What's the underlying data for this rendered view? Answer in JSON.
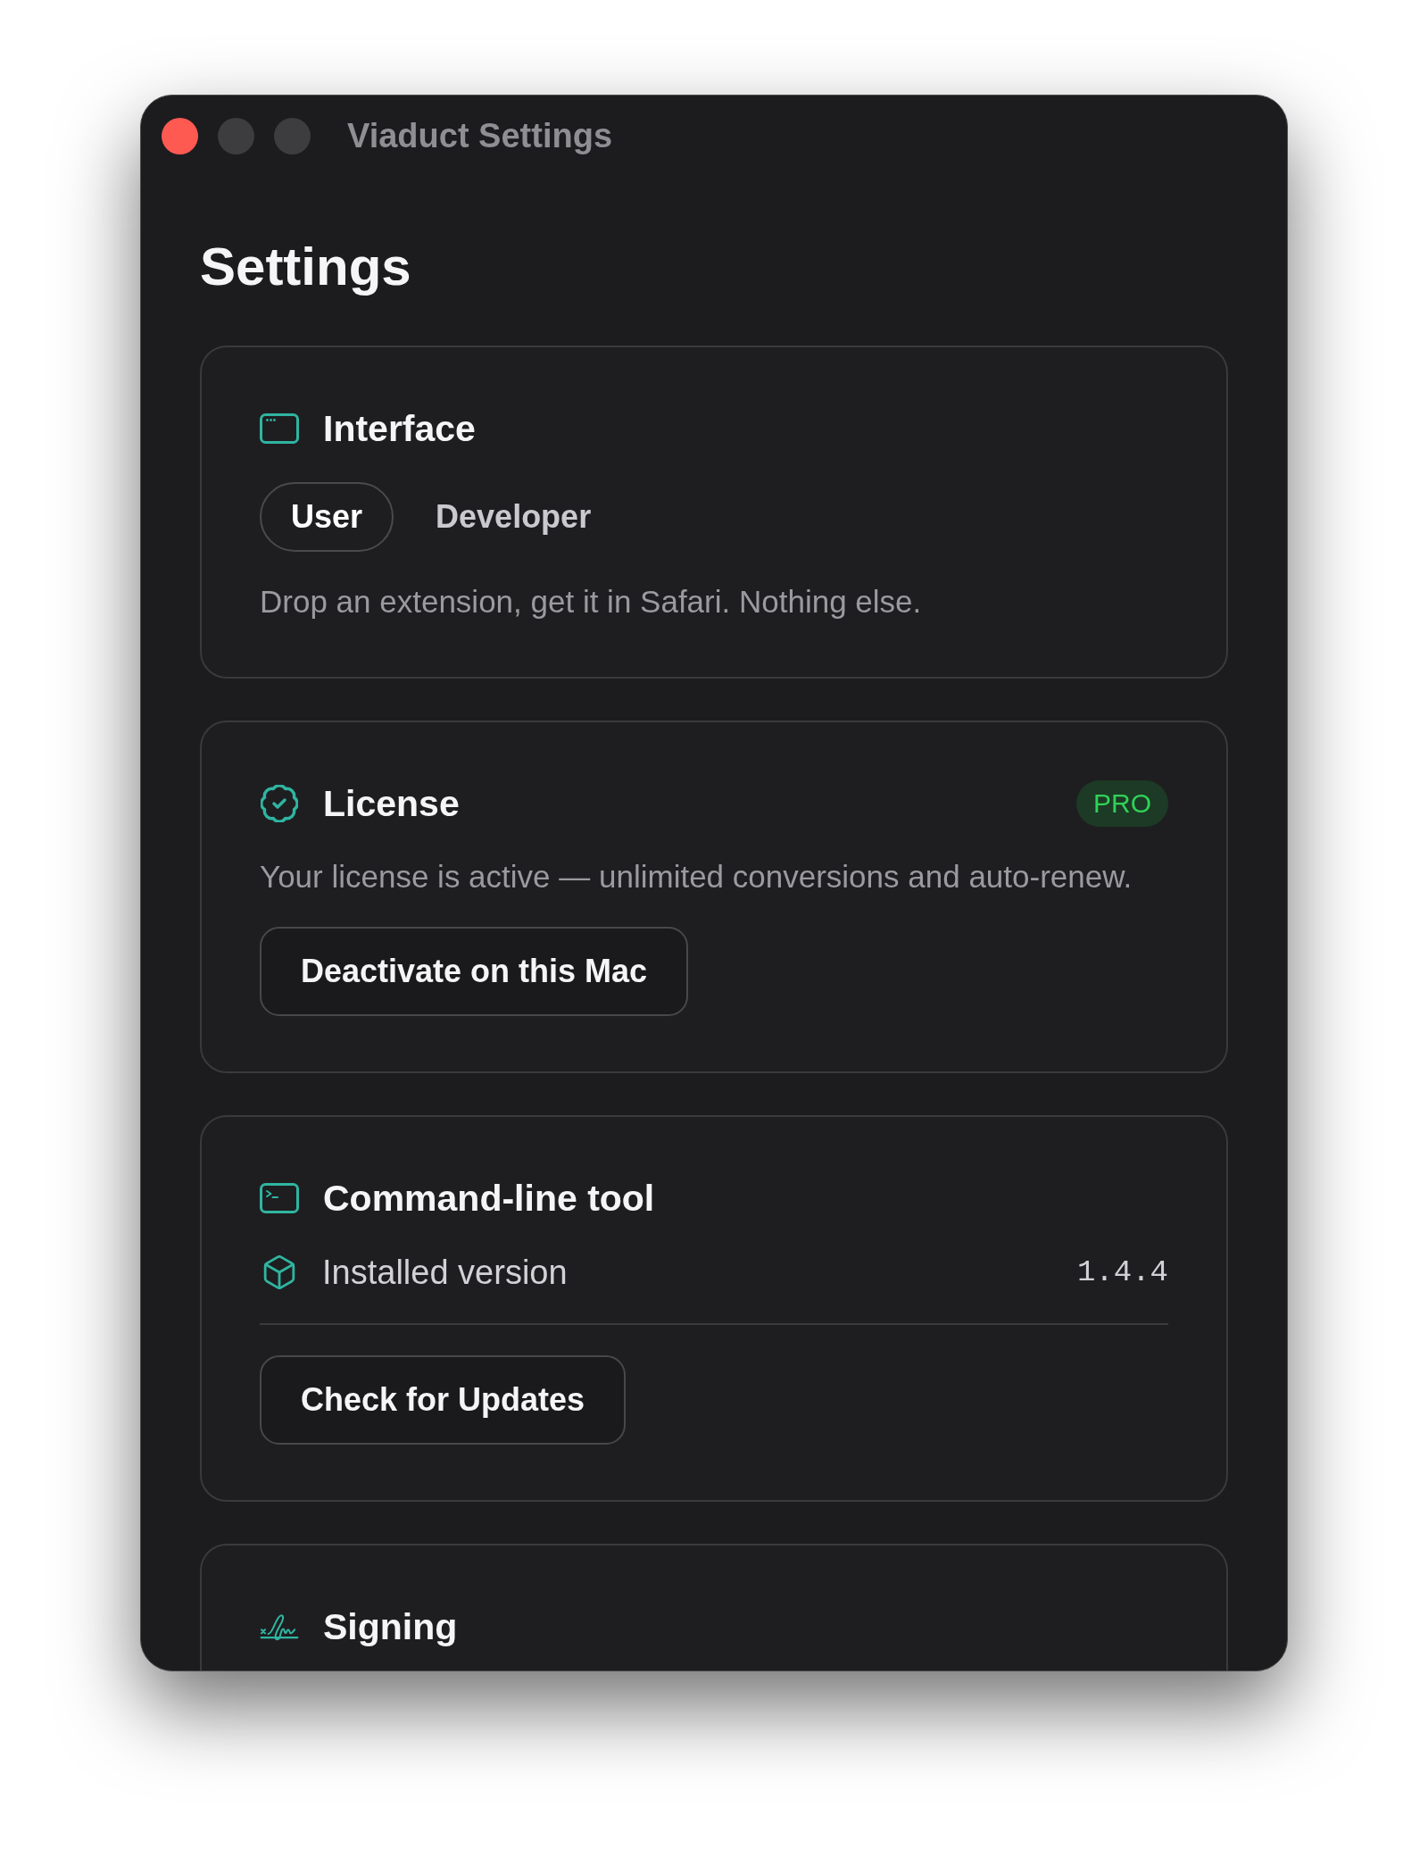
{
  "window": {
    "title": "Viaduct Settings"
  },
  "heading": "Settings",
  "sections": [
    {
      "kind": "segmented",
      "title": "Interface",
      "options": [
        {
          "label": "User",
          "selected": true
        },
        {
          "label": "Developer",
          "selected": false
        }
      ],
      "description": "Drop an extension, get it in Safari. Nothing else."
    },
    {
      "kind": "license",
      "title": "License",
      "badge": "PRO",
      "description": "Your license is active — unlimited conversions and auto-renew.",
      "button": "Deactivate on this Mac"
    },
    {
      "kind": "tool",
      "title": "Command-line tool",
      "rows": [
        {
          "label": "Installed version",
          "value": "1.4.4"
        }
      ],
      "button": "Check for Updates"
    },
    {
      "kind": "signing",
      "title": "Signing"
    }
  ]
}
